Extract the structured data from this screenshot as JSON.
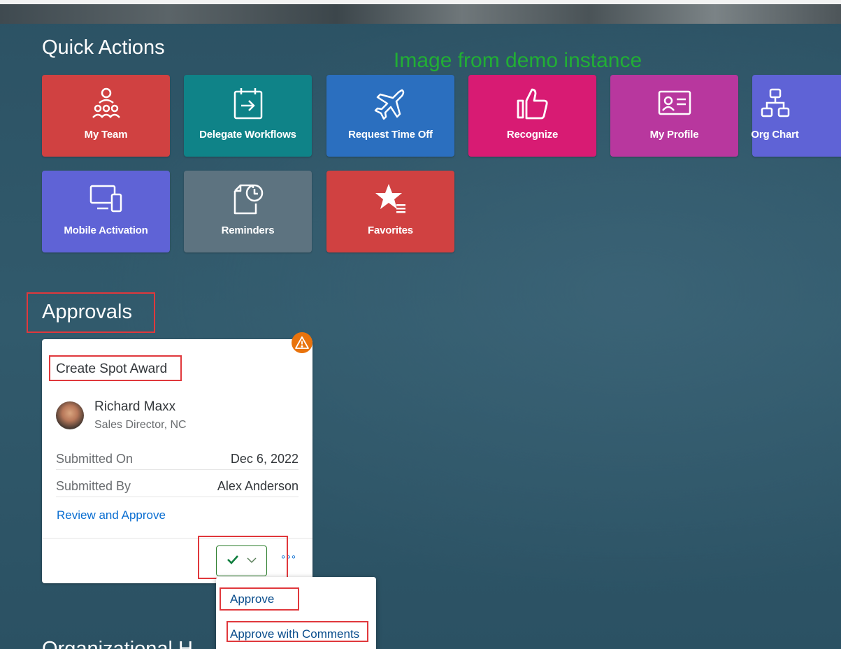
{
  "watermark": "Image from demo instance",
  "quick_actions": {
    "title": "Quick Actions",
    "tiles": [
      {
        "label": "My Team",
        "icon": "team-icon",
        "color": "#d04141"
      },
      {
        "label": "Delegate Workflows",
        "icon": "calendar-arrow-icon",
        "color": "#0f8388"
      },
      {
        "label": "Request Time Off",
        "icon": "airplane-icon",
        "color": "#2b6fbf"
      },
      {
        "label": "Recognize",
        "icon": "thumbs-up-icon",
        "color": "#d81b73"
      },
      {
        "label": "My Profile",
        "icon": "id-card-icon",
        "color": "#b8379e"
      },
      {
        "label": "Org Chart",
        "icon": "org-chart-icon",
        "color": "#5f63d6"
      },
      {
        "label": "Mobile Activation",
        "icon": "devices-icon",
        "color": "#5f63d6"
      },
      {
        "label": "Reminders",
        "icon": "document-clock-icon",
        "color": "#5d7380"
      },
      {
        "label": "Favorites",
        "icon": "star-list-icon",
        "color": "#d04141"
      }
    ]
  },
  "approvals": {
    "title": "Approvals",
    "card": {
      "title": "Create Spot Award",
      "person_name": "Richard Maxx",
      "person_role": "Sales Director, NC",
      "submitted_on_label": "Submitted On",
      "submitted_on_value": "Dec 6, 2022",
      "submitted_by_label": "Submitted By",
      "submitted_by_value": "Alex Anderson",
      "link": "Review and Approve",
      "more": "°°°"
    },
    "menu": {
      "approve": "Approve",
      "approve_with_comments": "Approve with Comments"
    }
  },
  "next_section_title": "Organizational H"
}
